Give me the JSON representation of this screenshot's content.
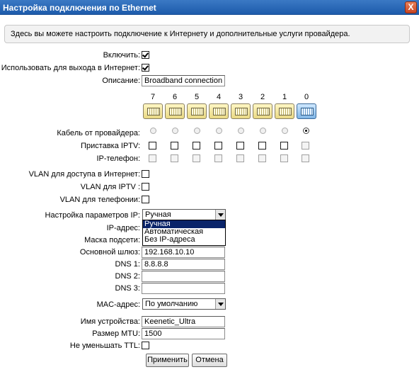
{
  "window": {
    "title": "Настройка подключения по Ethernet",
    "close_glyph": "X"
  },
  "info": "Здесь вы можете настроить подключение к Интернету и дополнительные услуги провайдера.",
  "labels": {
    "enable": "Включить:",
    "use_internet": "Использовать для выхода в Интернет:",
    "description": "Описание:",
    "provider_cable": "Кабель от провайдера:",
    "iptv_box": "Приставка IPTV:",
    "ip_phone": "IP-телефон:",
    "vlan_internet": "VLAN для доступа в Интернет:",
    "vlan_iptv": "VLAN для IPTV :",
    "vlan_phone": "VLAN для телефонии:",
    "ip_settings": "Настройка параметров IP:",
    "ip_address": "IP-адрес:",
    "subnet_mask": "Маска подсети:",
    "gateway": "Основной шлюз:",
    "dns1": "DNS 1:",
    "dns2": "DNS 2:",
    "dns3": "DNS 3:",
    "mac": "MAC-адрес:",
    "device_name": "Имя устройства:",
    "mtu": "Размер MTU:",
    "no_ttl": "Не уменьшать TTL:"
  },
  "values": {
    "enable": true,
    "use_internet": true,
    "description": "Broadband connection",
    "ip_settings": "Ручная",
    "gateway": "192.168.10.10",
    "dns1": "8.8.8.8",
    "dns2": "",
    "dns3": "",
    "mac": "По умолчанию",
    "device_name": "Keenetic_Ultra",
    "mtu": "1500",
    "no_ttl": false,
    "vlan_internet": false,
    "vlan_iptv": false,
    "vlan_phone": false
  },
  "ports": [
    "7",
    "6",
    "5",
    "4",
    "3",
    "2",
    "1",
    "0"
  ],
  "provider_cable_selected_port": "0",
  "ip_dropdown_options": [
    "Ручная",
    "Автоматическая",
    "Без IP-адреса"
  ],
  "buttons": {
    "apply": "Применить",
    "cancel": "Отмена"
  }
}
